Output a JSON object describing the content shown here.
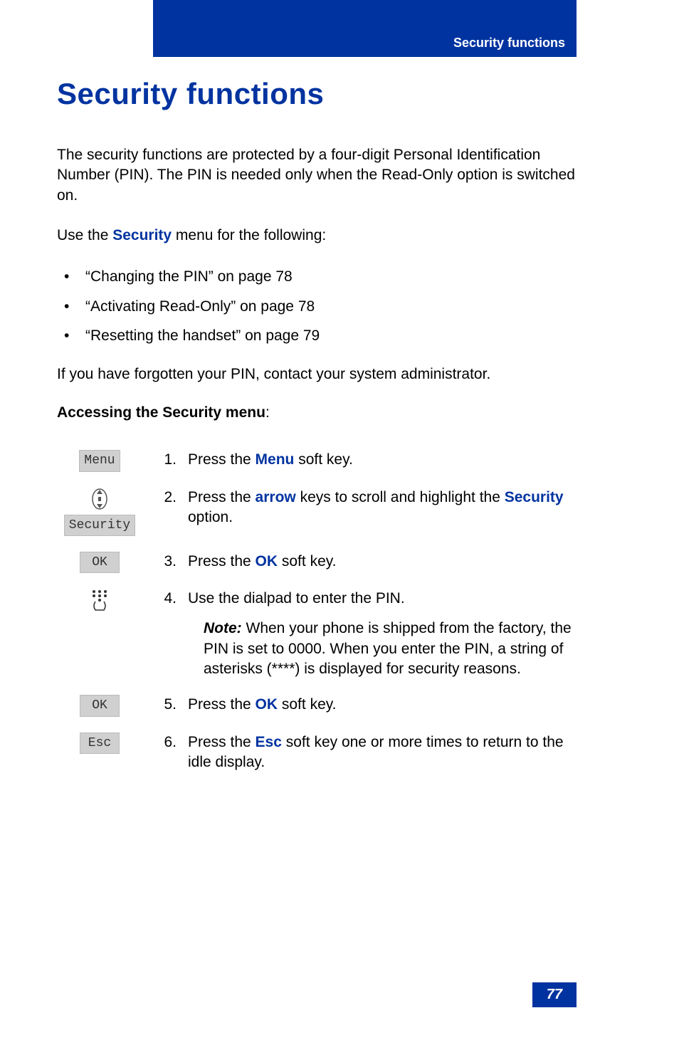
{
  "header": {
    "section_label": "Security functions"
  },
  "title": "Security functions",
  "intro": "The security functions are protected by a four-digit Personal Identification Number (PIN). The PIN is needed only when the Read-Only option is switched on.",
  "use_menu_prefix": "Use the ",
  "use_menu_keyword": "Security",
  "use_menu_suffix": " menu for the following:",
  "bullets": [
    "“Changing the PIN” on page 78",
    "“Activating Read-Only” on page 78",
    "“Resetting the handset” on page 79"
  ],
  "forgot": "If you have forgotten your PIN, contact your system administrator.",
  "access_heading": "Accessing the Security menu",
  "access_heading_colon": ":",
  "steps": {
    "s1": {
      "key_label": "Menu",
      "num": "1.",
      "pre": "Press the ",
      "kw": "Menu",
      "post": " soft key."
    },
    "s2": {
      "key_label": "Security",
      "num": "2.",
      "pre": "Press the ",
      "kw": "arrow",
      "mid": " keys to scroll and highlight the ",
      "kw2": "Security",
      "post": " option."
    },
    "s3": {
      "key_label": "OK",
      "num": "3.",
      "pre": "Press the ",
      "kw": "OK",
      "post": " soft key."
    },
    "s4": {
      "num": "4.",
      "text": "Use the dialpad to enter the PIN.",
      "note_label": "Note:",
      "note_text": " When your phone is shipped from the factory, the PIN is set to 0000. When you enter the PIN, a string of asterisks (****) is displayed for security reasons."
    },
    "s5": {
      "key_label": "OK",
      "num": "5.",
      "pre": "Press the ",
      "kw": "OK",
      "post": " soft key."
    },
    "s6": {
      "key_label": "Esc",
      "num": "6.",
      "pre": "Press the ",
      "kw": "Esc",
      "post": " soft key one or more times to return to the idle display."
    }
  },
  "page_number": "77"
}
